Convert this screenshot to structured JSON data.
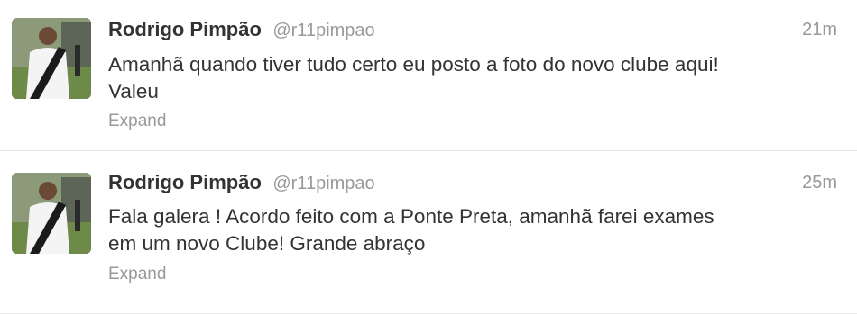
{
  "tweets": [
    {
      "fullname": "Rodrigo Pimpão",
      "username": "@r11pimpao",
      "time": "21m",
      "text_lines": [
        "Amanhã quando tiver tudo certo eu posto a foto do novo clube aqui!",
        "Valeu"
      ],
      "expand": "Expand",
      "avatar_icon": "player-photo"
    },
    {
      "fullname": "Rodrigo Pimpão",
      "username": "@r11pimpao",
      "time": "25m",
      "text_lines": [
        "Fala galera ! Acordo feito com a Ponte Preta, amanhã farei exames",
        "em um novo Clube! Grande abraço"
      ],
      "expand": "Expand",
      "avatar_icon": "player-photo"
    }
  ],
  "colors": {
    "name": "#333333",
    "meta": "#999999",
    "divider": "#e8e8e8"
  }
}
